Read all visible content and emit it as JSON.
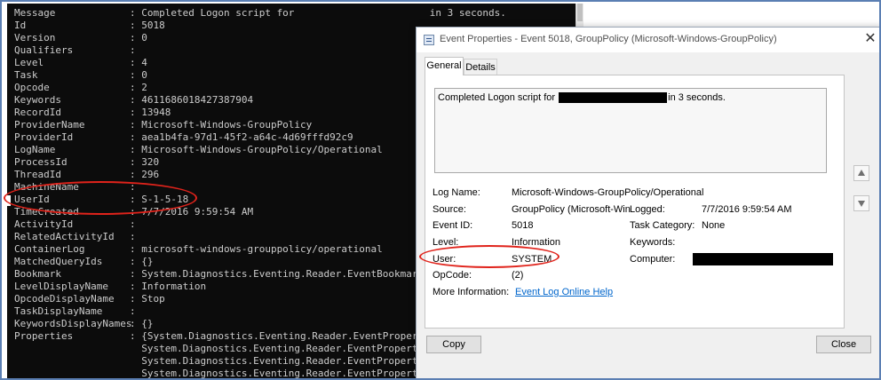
{
  "console": {
    "rows": [
      {
        "key": "Message",
        "value": ": Completed Logon script for                       in 3 seconds."
      },
      {
        "key": "Id",
        "value": ": 5018"
      },
      {
        "key": "Version",
        "value": ": 0"
      },
      {
        "key": "Qualifiers",
        "value": ":"
      },
      {
        "key": "Level",
        "value": ": 4"
      },
      {
        "key": "Task",
        "value": ": 0"
      },
      {
        "key": "Opcode",
        "value": ": 2"
      },
      {
        "key": "Keywords",
        "value": ": 4611686018427387904"
      },
      {
        "key": "RecordId",
        "value": ": 13948"
      },
      {
        "key": "ProviderName",
        "value": ": Microsoft-Windows-GroupPolicy"
      },
      {
        "key": "ProviderId",
        "value": ": aea1b4fa-97d1-45f2-a64c-4d69fffd92c9"
      },
      {
        "key": "LogName",
        "value": ": Microsoft-Windows-GroupPolicy/Operational"
      },
      {
        "key": "ProcessId",
        "value": ": 320"
      },
      {
        "key": "ThreadId",
        "value": ": 296"
      },
      {
        "key": "MachineName",
        "value": ":"
      },
      {
        "key": "UserId",
        "value": ": S-1-5-18"
      },
      {
        "key": "TimeCreated",
        "value": ": 7/7/2016 9:59:54 AM"
      },
      {
        "key": "ActivityId",
        "value": ":"
      },
      {
        "key": "RelatedActivityId",
        "value": ":"
      },
      {
        "key": "ContainerLog",
        "value": ": microsoft-windows-grouppolicy/operational"
      },
      {
        "key": "MatchedQueryIds",
        "value": ": {}"
      },
      {
        "key": "Bookmark",
        "value": ": System.Diagnostics.Eventing.Reader.EventBookmark"
      },
      {
        "key": "LevelDisplayName",
        "value": ": Information"
      },
      {
        "key": "OpcodeDisplayName",
        "value": ": Stop"
      },
      {
        "key": "TaskDisplayName",
        "value": ":"
      },
      {
        "key": "KeywordsDisplayNames",
        "value": ": {}"
      },
      {
        "key": "Properties",
        "value": ": {System.Diagnostics.Eventing.Reader.EventProperty,"
      },
      {
        "key": "",
        "value": "  System.Diagnostics.Eventing.Reader.EventProperty,"
      },
      {
        "key": "",
        "value": "  System.Diagnostics.Eventing.Reader.EventProperty,"
      },
      {
        "key": "",
        "value": "  System.Diagnostics.Eventing.Reader.EventProperty}"
      }
    ]
  },
  "dialog": {
    "title": "Event Properties - Event 5018, GroupPolicy (Microsoft-Windows-GroupPolicy)",
    "close_glyph": "✕",
    "tabs": [
      "General",
      "Details"
    ],
    "message_before": "Completed Logon script for ",
    "message_after": "in 3 seconds.",
    "fields": {
      "log_name_label": "Log Name:",
      "log_name_value": "Microsoft-Windows-GroupPolicy/Operational",
      "source_label": "Source:",
      "source_value": "GroupPolicy (Microsoft-Win",
      "logged_label": "Logged:",
      "logged_value": "7/7/2016 9:59:54 AM",
      "event_id_label": "Event ID:",
      "event_id_value": "5018",
      "task_category_label": "Task Category:",
      "task_category_value": "None",
      "level_label": "Level:",
      "level_value": "Information",
      "keywords_label": "Keywords:",
      "keywords_value": "",
      "user_label": "User:",
      "user_value": "SYSTEM",
      "computer_label": "Computer:",
      "opcode_label": "OpCode:",
      "opcode_value": "(2)",
      "more_info_label": "More Information:",
      "more_info_link": "Event Log Online Help"
    },
    "buttons": {
      "copy": "Copy",
      "close": "Close"
    }
  },
  "icons": {
    "dialog_icon": "event-viewer-icon",
    "prev": "arrow-up-icon",
    "next": "arrow-down-icon"
  },
  "colors": {
    "console_bg": "#0c0c0c",
    "console_text": "#cccccc",
    "annotation": "#e0231b",
    "link": "#0066cc",
    "frame_border": "#5b7fb3"
  }
}
